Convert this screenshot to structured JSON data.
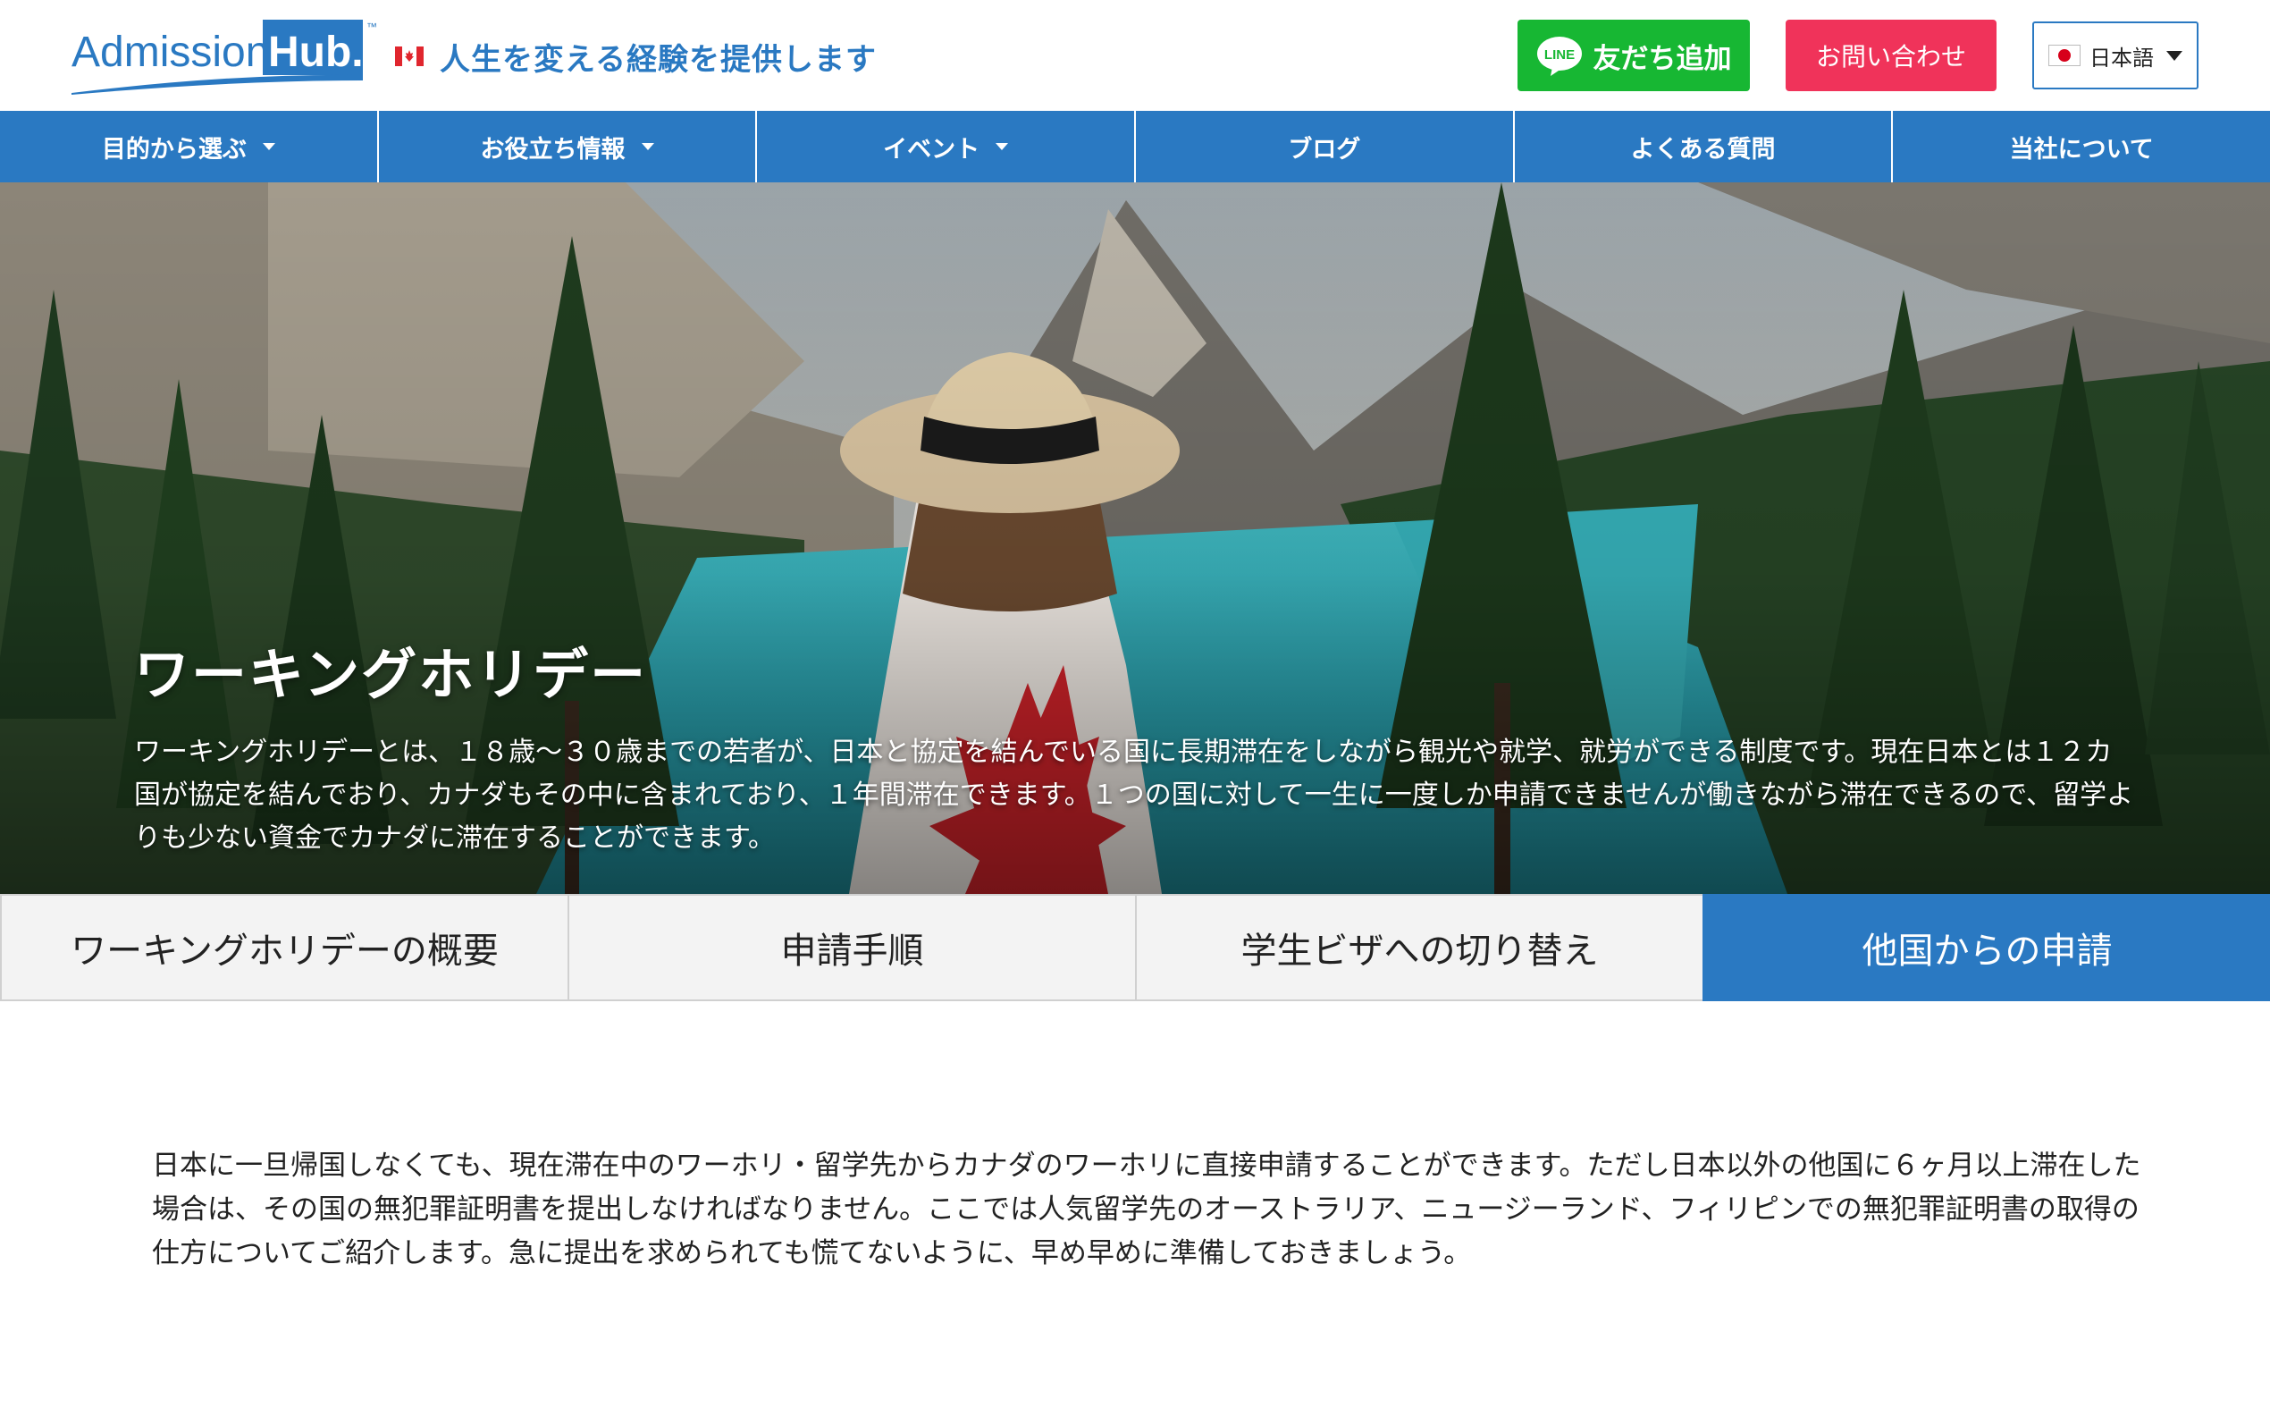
{
  "header": {
    "logo_text_admission": "Admission",
    "logo_text_hub": "Hub.",
    "logo_tm": "™",
    "tagline": "人生を変える経験を提供します",
    "line_button": "友だち追加",
    "line_icon_text": "LINE",
    "contact_button": "お問い合わせ",
    "language": "日本語"
  },
  "nav": {
    "items": [
      {
        "label": "目的から選ぶ"
      },
      {
        "label": "お役立ち情報"
      },
      {
        "label": "イベント"
      },
      {
        "label": "ブログ"
      },
      {
        "label": "よくある質問"
      },
      {
        "label": "当社について"
      }
    ]
  },
  "hero": {
    "title": "ワーキングホリデー",
    "description": "ワーキングホリデーとは、１８歳〜３０歳までの若者が、日本と協定を結んでいる国に長期滞在をしながら観光や就学、就労ができる制度です。現在日本とは１２カ国が協定を結んでおり、カナダもその中に含まれており、１年間滞在できます。１つの国に対して一生に一度しか申請できませんが働きながら滞在できるので、留学よりも少ない資金でカナダに滞在することができます。"
  },
  "tabs": [
    {
      "label": "ワーキングホリデーの概要"
    },
    {
      "label": "申請手順"
    },
    {
      "label": "学生ビザへの切り替え"
    },
    {
      "label": "他国からの申請"
    }
  ],
  "main": {
    "intro": "日本に一旦帰国しなくても、現在滞在中のワーホリ・留学先からカナダのワーホリに直接申請することができます。ただし日本以外の他国に６ヶ月以上滞在した場合は、その国の無犯罪証明書を提出しなければなりません。ここでは人気留学先のオーストラリア、ニュージーランド、フィリピンでの無犯罪証明書の取得の仕方についてご紹介します。急に提出を求められても慌てないように、早め早めに準備しておきましょう。"
  },
  "colors": {
    "brand_blue": "#2a79c2",
    "line_green": "#17b733",
    "contact_pink": "#f0335a"
  }
}
